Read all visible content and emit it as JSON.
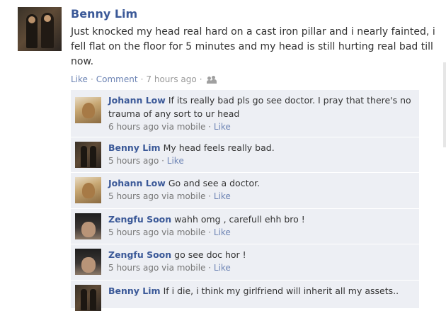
{
  "post": {
    "author": "Benny Lim",
    "text": "Just knocked my head real hard on a cast iron pillar and i nearly fainted, i fell flat on the floor for 5 minutes and my head is still hurting real bad till now.",
    "like_label": "Like",
    "comment_label": "Comment",
    "time": "7 hours ago",
    "icon": "friends-icon"
  },
  "comments": [
    {
      "author": "Johann Low",
      "text": "If its really bad pls go see doctor. I pray that there's no trauma of any sort to ur head",
      "time": "6 hours ago via mobile",
      "like_label": "Like",
      "avatar": "johann"
    },
    {
      "author": "Benny Lim",
      "text": "My head feels really bad.",
      "time": "5 hours ago",
      "like_label": "Like",
      "avatar": "benny"
    },
    {
      "author": "Johann Low",
      "text": "Go and see a doctor.",
      "time": "5 hours ago via mobile",
      "like_label": "Like",
      "avatar": "johann"
    },
    {
      "author": "Zengfu Soon",
      "text": "wahh omg , carefull ehh bro !",
      "time": "5 hours ago via mobile",
      "like_label": "Like",
      "avatar": "zengfu"
    },
    {
      "author": "Zengfu Soon",
      "text": "go see doc hor !",
      "time": "5 hours ago via mobile",
      "like_label": "Like",
      "avatar": "zengfu"
    },
    {
      "author": "Benny Lim",
      "text": "If i die, i think my girlfriend will inherit all my assets..",
      "time": "",
      "like_label": "",
      "avatar": "benny"
    }
  ]
}
